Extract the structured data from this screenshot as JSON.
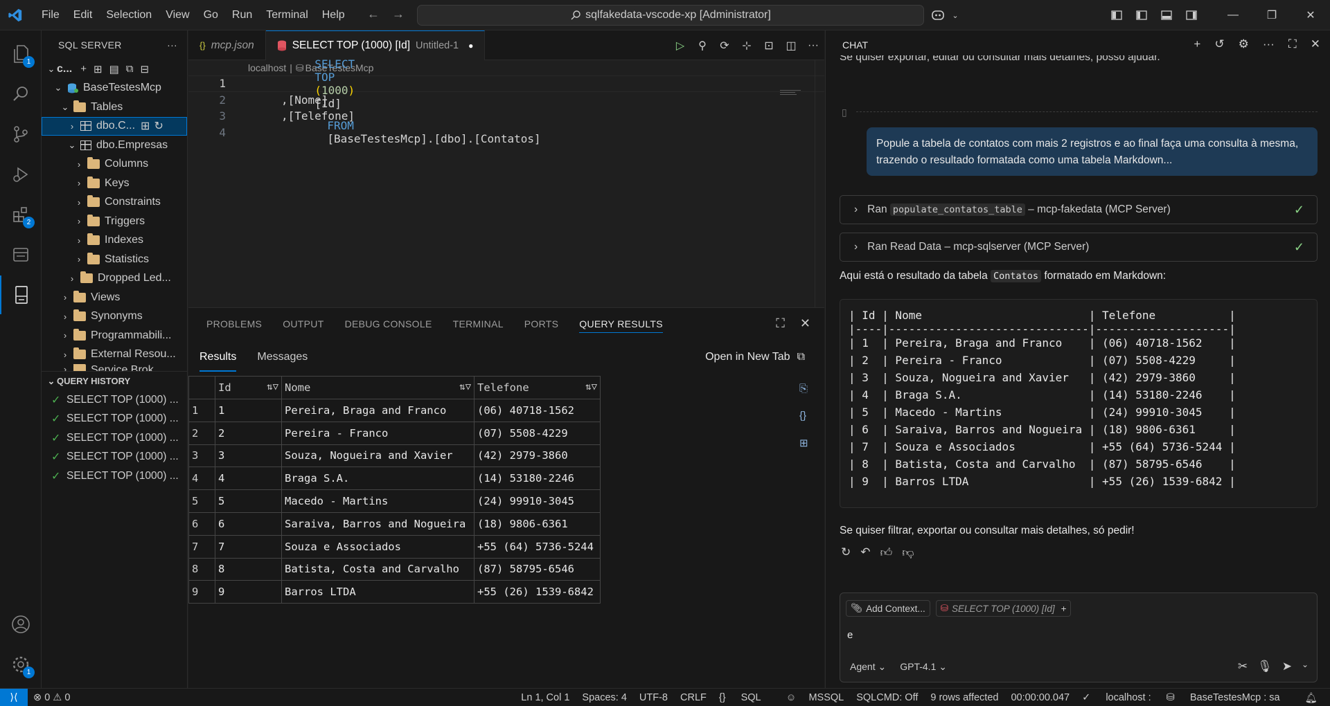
{
  "titlebar": {
    "menu": [
      "File",
      "Edit",
      "Selection",
      "View",
      "Go",
      "Run",
      "Terminal",
      "Help"
    ],
    "search_text": "sqlfakedata-vscode-xp [Administrator]"
  },
  "activity_badges": {
    "explorer": "1",
    "extensions": "2",
    "settings": "1"
  },
  "sidebar": {
    "title": "SQL SERVER",
    "more": "···",
    "connection": "c...",
    "database": "BaseTestesMcp",
    "tables": "Tables",
    "selected_table": "dbo.C...",
    "empresas": "dbo.Empresas",
    "empresas_children": [
      "Columns",
      "Keys",
      "Constraints",
      "Triggers",
      "Indexes",
      "Statistics"
    ],
    "dropped": "Dropped Led...",
    "db_children": [
      "Views",
      "Synonyms",
      "Programmabili...",
      "External Resou...",
      "Service Brok..."
    ],
    "history_title": "QUERY HISTORY",
    "history": [
      "SELECT TOP (1000) ...",
      "SELECT TOP (1000) ...",
      "SELECT TOP (1000) ...",
      "SELECT TOP (1000) ...",
      "SELECT TOP (1000) ..."
    ]
  },
  "editor": {
    "tab1": "mcp.json",
    "tab2": "SELECT TOP (1000) [Id]",
    "tab2_sub": "Untitled-1",
    "breadcrumb_host": "localhost",
    "breadcrumb_sep": "|",
    "breadcrumb_db": "BaseTestesMcp",
    "lines": [
      "1",
      "2",
      "3",
      "4"
    ],
    "code": {
      "l1_kw1": "SELECT",
      "l1_kw2": "TOP",
      "l1_num": "1000",
      "l1_id": "[Id]",
      "l2": ",[Nome]",
      "l3": ",[Telefone]",
      "l4_kw": "FROM",
      "l4_a": "[BaseTestesMcp]",
      "l4_b": "[dbo]",
      "l4_c": "[Contatos]"
    }
  },
  "panel": {
    "tabs": [
      "PROBLEMS",
      "OUTPUT",
      "DEBUG CONSOLE",
      "TERMINAL",
      "PORTS",
      "QUERY RESULTS"
    ],
    "results_tab": "Results",
    "messages_tab": "Messages",
    "open_new_tab": "Open in New Tab",
    "columns": [
      "Id",
      "Nome",
      "Telefone"
    ],
    "rows": [
      [
        "1",
        "1",
        "Pereira, Braga and Franco",
        "(06) 40718-1562"
      ],
      [
        "2",
        "2",
        "Pereira - Franco",
        "(07) 5508-4229"
      ],
      [
        "3",
        "3",
        "Souza, Nogueira and Xavier",
        "(42) 2979-3860"
      ],
      [
        "4",
        "4",
        "Braga S.A.",
        "(14) 53180-2246"
      ],
      [
        "5",
        "5",
        "Macedo - Martins",
        "(24) 99910-3045"
      ],
      [
        "6",
        "6",
        "Saraiva, Barros and Nogueira",
        "(18) 9806-6361"
      ],
      [
        "7",
        "7",
        "Souza e Associados",
        "+55 (64) 5736-5244"
      ],
      [
        "8",
        "8",
        "Batista, Costa and Carvalho",
        "(87) 58795-6546"
      ],
      [
        "9",
        "9",
        "Barros LTDA",
        "+55 (26) 1539-6842"
      ]
    ]
  },
  "chat": {
    "title": "CHAT",
    "cut_text": "Se quiser exportar, editar ou consultar mais detalhes, posso ajudar.",
    "user_message": "Popule a tabela de contatos com mais 2 registros e ao final faça uma consulta à mesma, trazendo o resultado formatada como uma tabela Markdown...",
    "tool1_prefix": "Ran",
    "tool1_code": "populate_contatos_table",
    "tool1_suffix": "– mcp-fakedata (MCP Server)",
    "tool2_text": "Ran Read Data – mcp-sqlserver (MCP Server)",
    "result_prefix": "Aqui está o resultado da tabela",
    "result_code": "Contatos",
    "result_suffix": "formatado em Markdown:",
    "md_lines": [
      "| Id | Nome                         | Telefone           |",
      "|----|------------------------------|--------------------|",
      "| 1  | Pereira, Braga and Franco    | (06) 40718-1562    |",
      "| 2  | Pereira - Franco             | (07) 5508-4229     |",
      "| 3  | Souza, Nogueira and Xavier   | (42) 2979-3860     |",
      "| 4  | Braga S.A.                   | (14) 53180-2246    |",
      "| 5  | Macedo - Martins             | (24) 99910-3045    |",
      "| 6  | Saraiva, Barros and Nogueira | (18) 9806-6361     |",
      "| 7  | Souza e Associados           | +55 (64) 5736-5244 |",
      "| 8  | Batista, Costa and Carvalho  | (87) 58795-6546    |",
      "| 9  | Barros LTDA                  | +55 (26) 1539-6842 |"
    ],
    "closing": "Se quiser filtrar, exportar ou consultar mais detalhes, só pedir!",
    "add_context": "Add Context...",
    "context_file": "SELECT TOP (1000) [Id]",
    "input_value": "e",
    "mode": "Agent",
    "model": "GPT-4.1"
  },
  "statusbar": {
    "problems": "0",
    "warnings": "0",
    "position": "Ln 1, Col 1",
    "spaces": "Spaces: 4",
    "encoding": "UTF-8",
    "eol": "CRLF",
    "language": "SQL",
    "mssql": "MSSQL",
    "sqlcmd": "SQLCMD: Off",
    "rows_affected": "9 rows affected",
    "elapsed": "00:00:00.047",
    "connection": "localhost :",
    "connection_db": "BaseTestesMcp : sa"
  }
}
